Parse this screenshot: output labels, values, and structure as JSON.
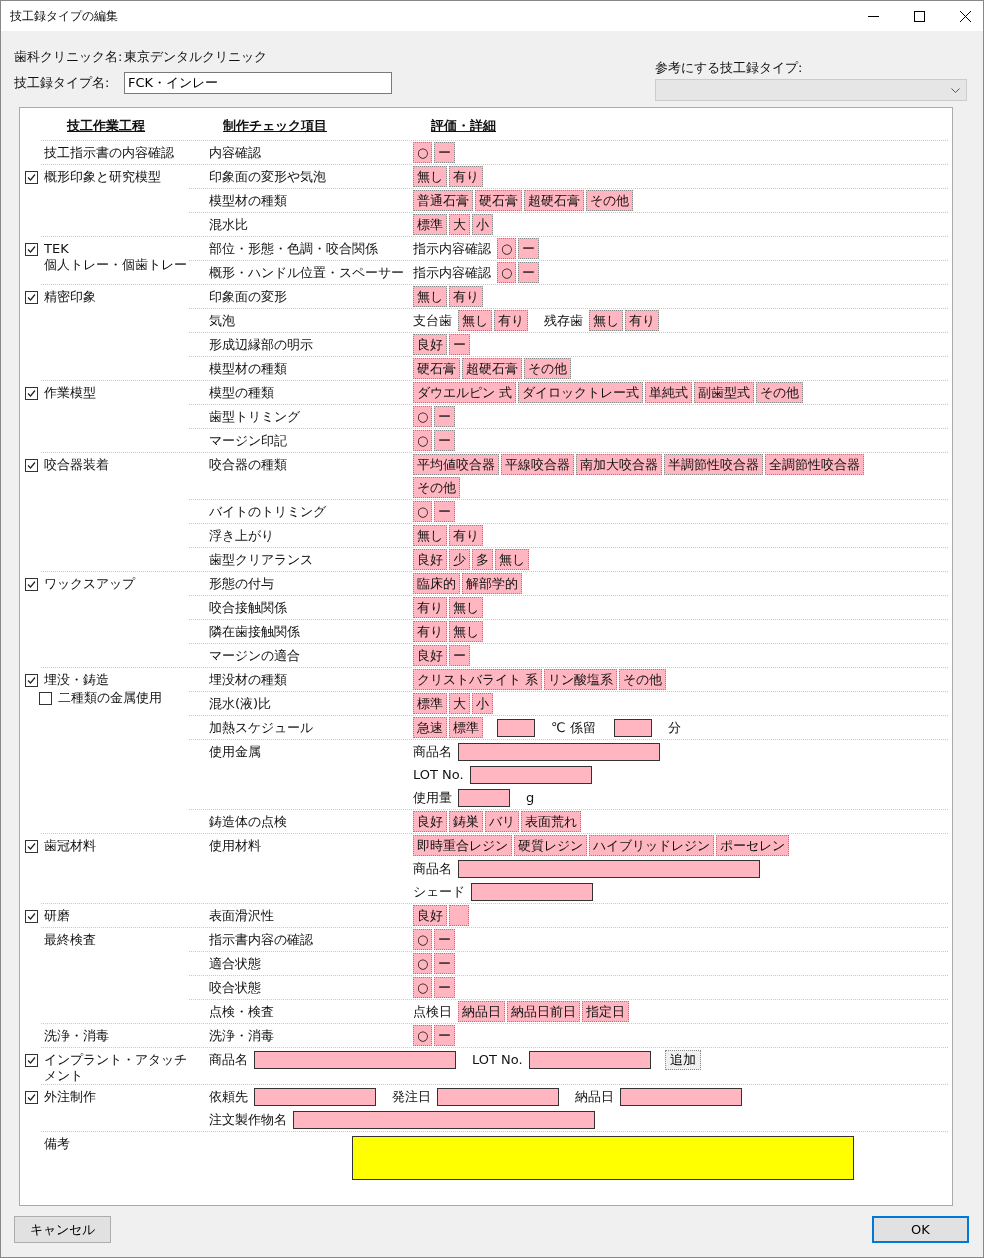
{
  "window": {
    "title": "技工録タイプの編集"
  },
  "clinic": {
    "label": "歯科クリニック名:",
    "value": "東京デンタルクリニック"
  },
  "type_name": {
    "label": "技工録タイプ名:",
    "value": "FCK・インレー"
  },
  "reference": {
    "label": "参考にする技工録タイプ:"
  },
  "headers": [
    "技工作業工程",
    "制作チェック項目",
    "評価・詳細"
  ],
  "sections": [
    {
      "label": "技工指示書の内容確認",
      "items": [
        {
          "kind": "row",
          "name": "内容確認",
          "lines": [
            [
              {
                "kind": "chip",
                "text": "○"
              },
              {
                "kind": "chip",
                "text": "ー"
              }
            ]
          ]
        }
      ]
    },
    {
      "label": "概形印象と研究模型",
      "checked": true,
      "items": [
        {
          "kind": "row",
          "name": "印象面の変形や気泡",
          "lines": [
            [
              {
                "kind": "chip",
                "text": "無し"
              },
              {
                "kind": "chip",
                "text": "有り"
              }
            ]
          ]
        },
        {
          "kind": "row",
          "name": "模型材の種類",
          "lines": [
            [
              {
                "kind": "chip",
                "text": "普通石膏"
              },
              {
                "kind": "chip",
                "text": "硬石膏"
              },
              {
                "kind": "chip",
                "text": "超硬石膏"
              },
              {
                "kind": "chip",
                "text": "その他"
              }
            ]
          ]
        },
        {
          "kind": "row",
          "name": "混水比",
          "lines": [
            [
              {
                "kind": "chip",
                "text": "標準"
              },
              {
                "kind": "chip",
                "text": "大"
              },
              {
                "kind": "chip",
                "text": "小"
              }
            ]
          ]
        }
      ]
    },
    {
      "label": "TEK\n個人トレー・個歯トレー",
      "checked": true,
      "items": [
        {
          "kind": "row",
          "name": "部位・形態・色調・咬合関係",
          "lines": [
            [
              {
                "kind": "text",
                "text": "指示内容確認"
              },
              {
                "kind": "chip",
                "text": "○"
              },
              {
                "kind": "chip",
                "text": "ー"
              }
            ]
          ]
        },
        {
          "kind": "row",
          "name": "概形・ハンドル位置・スペーサー",
          "lines": [
            [
              {
                "kind": "text",
                "text": "指示内容確認"
              },
              {
                "kind": "chip",
                "text": "○"
              },
              {
                "kind": "chip",
                "text": "ー"
              }
            ]
          ]
        }
      ]
    },
    {
      "label": "精密印象",
      "checked": true,
      "items": [
        {
          "kind": "row",
          "name": "印象面の変形",
          "lines": [
            [
              {
                "kind": "chip",
                "text": "無し"
              },
              {
                "kind": "chip",
                "text": "有り"
              }
            ]
          ]
        },
        {
          "kind": "row",
          "name": "気泡",
          "lines": [
            [
              {
                "kind": "text",
                "text": "支台歯"
              },
              {
                "kind": "chip",
                "text": "無し"
              },
              {
                "kind": "chip",
                "text": "有り"
              },
              {
                "kind": "text",
                "text": "残存歯"
              },
              {
                "kind": "chip",
                "text": "無し"
              },
              {
                "kind": "chip",
                "text": "有り"
              }
            ]
          ]
        },
        {
          "kind": "row",
          "name": "形成辺縁部の明示",
          "lines": [
            [
              {
                "kind": "chip",
                "text": "良好"
              },
              {
                "kind": "chip",
                "text": "ー"
              }
            ]
          ]
        },
        {
          "kind": "row",
          "name": "模型材の種類",
          "lines": [
            [
              {
                "kind": "chip",
                "text": "硬石膏"
              },
              {
                "kind": "chip",
                "text": "超硬石膏"
              },
              {
                "kind": "chip",
                "text": "その他"
              }
            ]
          ]
        }
      ]
    },
    {
      "label": "作業模型",
      "checked": true,
      "items": [
        {
          "kind": "row",
          "name": "模型の種類",
          "lines": [
            [
              {
                "kind": "chip",
                "text": "ダウエルピン 式"
              },
              {
                "kind": "chip",
                "text": "ダイロックトレー式"
              },
              {
                "kind": "chip",
                "text": "単純式"
              },
              {
                "kind": "chip",
                "text": "副歯型式"
              },
              {
                "kind": "chip",
                "text": "その他"
              }
            ]
          ]
        },
        {
          "kind": "row",
          "name": "歯型トリミング",
          "lines": [
            [
              {
                "kind": "chip",
                "text": "○"
              },
              {
                "kind": "chip",
                "text": "ー"
              }
            ]
          ]
        },
        {
          "kind": "row",
          "name": "マージン印記",
          "lines": [
            [
              {
                "kind": "chip",
                "text": "○"
              },
              {
                "kind": "chip",
                "text": "ー"
              }
            ]
          ]
        }
      ]
    },
    {
      "label": "咬合器装着",
      "checked": true,
      "items": [
        {
          "kind": "row",
          "name": "咬合器の種類",
          "lines": [
            [
              {
                "kind": "chip",
                "text": "平均値咬合器"
              },
              {
                "kind": "chip",
                "text": "平線咬合器"
              },
              {
                "kind": "chip",
                "text": "南加大咬合器"
              },
              {
                "kind": "chip",
                "text": "半調節性咬合器"
              },
              {
                "kind": "chip",
                "text": "全調節性咬合器"
              }
            ],
            [
              {
                "kind": "chip",
                "text": "その他"
              }
            ]
          ]
        },
        {
          "kind": "row",
          "name": "バイトのトリミング",
          "lines": [
            [
              {
                "kind": "chip",
                "text": "○"
              },
              {
                "kind": "chip",
                "text": "ー"
              }
            ]
          ]
        },
        {
          "kind": "row",
          "name": "浮き上がり",
          "lines": [
            [
              {
                "kind": "chip",
                "text": "無し"
              },
              {
                "kind": "chip",
                "text": "有り"
              }
            ]
          ]
        },
        {
          "kind": "row",
          "name": "歯型クリアランス",
          "lines": [
            [
              {
                "kind": "chip",
                "text": "良好"
              },
              {
                "kind": "chip",
                "text": "少"
              },
              {
                "kind": "chip",
                "text": "多"
              },
              {
                "kind": "chip",
                "text": "無し"
              }
            ]
          ]
        }
      ]
    },
    {
      "label": "ワックスアップ",
      "checked": true,
      "items": [
        {
          "kind": "row",
          "name": "形態の付与",
          "lines": [
            [
              {
                "kind": "chip",
                "text": "臨床的"
              },
              {
                "kind": "chip",
                "text": "解部学的"
              }
            ]
          ]
        },
        {
          "kind": "row",
          "name": "咬合接触関係",
          "lines": [
            [
              {
                "kind": "chip",
                "text": "有り"
              },
              {
                "kind": "chip",
                "text": "無し"
              }
            ]
          ]
        },
        {
          "kind": "row",
          "name": "隣在歯接触関係",
          "lines": [
            [
              {
                "kind": "chip",
                "text": "有り"
              },
              {
                "kind": "chip",
                "text": "無し"
              }
            ]
          ]
        },
        {
          "kind": "row",
          "name": "マージンの適合",
          "lines": [
            [
              {
                "kind": "chip",
                "text": "良好"
              },
              {
                "kind": "chip",
                "text": "ー"
              }
            ]
          ]
        }
      ]
    },
    {
      "label": "埋没・鋳造",
      "checked": true,
      "sub": {
        "label": "二種類の金属使用",
        "checked": false
      },
      "items": [
        {
          "kind": "row",
          "name": "埋没材の種類",
          "lines": [
            [
              {
                "kind": "chip",
                "text": "クリストバライト 系"
              },
              {
                "kind": "chip",
                "text": "リン酸塩系"
              },
              {
                "kind": "chip",
                "text": "その他"
              }
            ]
          ]
        },
        {
          "kind": "row",
          "name": "混水(液)比",
          "lines": [
            [
              {
                "kind": "chip",
                "text": "標準"
              },
              {
                "kind": "chip",
                "text": "大"
              },
              {
                "kind": "chip",
                "text": "小"
              }
            ]
          ]
        },
        {
          "kind": "row",
          "name": "加熱スケジュール",
          "lines": [
            [
              {
                "kind": "chip",
                "text": "急速"
              },
              {
                "kind": "chip",
                "text": "標準"
              },
              {
                "kind": "field_xs"
              },
              {
                "kind": "text",
                "text": "℃ 係留"
              },
              {
                "kind": "field_xs"
              },
              {
                "kind": "text",
                "text": "分"
              }
            ]
          ]
        },
        {
          "kind": "row",
          "name": "使用金属",
          "lines": [
            [
              {
                "kind": "text",
                "text": "商品名"
              },
              {
                "kind": "field_l"
              }
            ],
            [
              {
                "kind": "text",
                "text": "LOT No."
              },
              {
                "kind": "field_m"
              }
            ],
            [
              {
                "kind": "text",
                "text": "使用量"
              },
              {
                "kind": "field_s"
              },
              {
                "kind": "text",
                "text": "g"
              }
            ]
          ]
        },
        {
          "kind": "row",
          "name": "鋳造体の点検",
          "lines": [
            [
              {
                "kind": "chip",
                "text": "良好"
              },
              {
                "kind": "chip",
                "text": "鋳巣"
              },
              {
                "kind": "chip",
                "text": "バリ"
              },
              {
                "kind": "chip",
                "text": "表面荒れ"
              }
            ]
          ]
        }
      ]
    },
    {
      "label": "歯冠材料",
      "checked": true,
      "items": [
        {
          "kind": "row",
          "name": "使用材料",
          "lines": [
            [
              {
                "kind": "chip",
                "text": "即時重合レジン"
              },
              {
                "kind": "chip",
                "text": "硬質レジン"
              },
              {
                "kind": "chip",
                "text": "ハイブリッドレジン"
              },
              {
                "kind": "chip",
                "text": "ポーセレン"
              }
            ],
            [
              {
                "kind": "text",
                "text": "商品名"
              },
              {
                "kind": "field_xl"
              }
            ],
            [
              {
                "kind": "text",
                "text": "シェード"
              },
              {
                "kind": "field_m"
              }
            ]
          ]
        }
      ]
    },
    {
      "label": "研磨",
      "checked": true,
      "items": [
        {
          "kind": "row",
          "name": "表面滑沢性",
          "lines": [
            [
              {
                "kind": "chip",
                "text": "良好"
              },
              {
                "kind": "blank_chip"
              }
            ]
          ]
        }
      ]
    },
    {
      "label": "最終検査",
      "items": [
        {
          "kind": "row",
          "name": "指示書内容の確認",
          "lines": [
            [
              {
                "kind": "chip",
                "text": "○"
              },
              {
                "kind": "chip",
                "text": "ー"
              }
            ]
          ]
        },
        {
          "kind": "row",
          "name": "適合状態",
          "lines": [
            [
              {
                "kind": "chip",
                "text": "○"
              },
              {
                "kind": "chip",
                "text": "ー"
              }
            ]
          ]
        },
        {
          "kind": "row",
          "name": "咬合状態",
          "lines": [
            [
              {
                "kind": "chip",
                "text": "○"
              },
              {
                "kind": "chip",
                "text": "ー"
              }
            ]
          ]
        },
        {
          "kind": "row",
          "name": "点検・検査",
          "lines": [
            [
              {
                "kind": "text",
                "text": "点検日"
              },
              {
                "kind": "chip",
                "text": "納品日"
              },
              {
                "kind": "chip",
                "text": "納品日前日"
              },
              {
                "kind": "chip",
                "text": "指定日"
              }
            ]
          ]
        }
      ]
    },
    {
      "label": "洗浄・消毒",
      "items": [
        {
          "kind": "row",
          "name": "洗浄・消毒",
          "lines": [
            [
              {
                "kind": "chip",
                "text": "○"
              },
              {
                "kind": "chip",
                "text": "ー"
              }
            ]
          ]
        }
      ]
    },
    {
      "label": "インプラント・アタッチメント",
      "checked": true,
      "items": [
        {
          "kind": "wide",
          "lines": [
            [
              {
                "kind": "text",
                "text": "商品名"
              },
              {
                "kind": "field_l"
              },
              {
                "kind": "text",
                "text": "LOT No."
              },
              {
                "kind": "field_m"
              },
              {
                "kind": "button",
                "text": "追加"
              }
            ]
          ]
        }
      ]
    },
    {
      "label": "外注制作",
      "checked": true,
      "items": [
        {
          "kind": "wide",
          "lines": [
            [
              {
                "kind": "text",
                "text": "依頼先"
              },
              {
                "kind": "field_m"
              },
              {
                "kind": "text",
                "text": "発注日"
              },
              {
                "kind": "field_m"
              },
              {
                "kind": "text",
                "text": "納品日"
              },
              {
                "kind": "field_m"
              }
            ],
            [
              {
                "kind": "text",
                "text": "注文製作物名"
              },
              {
                "kind": "field_xl"
              }
            ]
          ]
        }
      ]
    },
    {
      "label": "備考",
      "items": [
        {
          "kind": "memo"
        }
      ]
    }
  ],
  "buttons": {
    "cancel": "キャンセル",
    "ok": "OK"
  }
}
